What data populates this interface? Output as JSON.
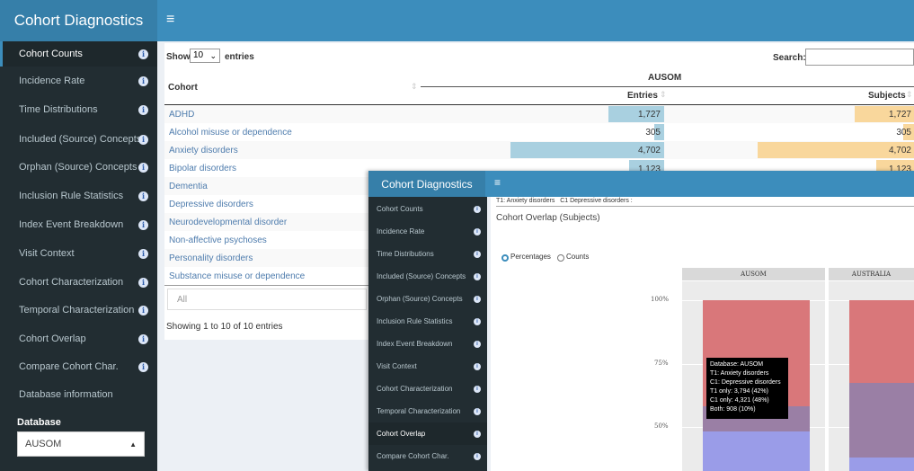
{
  "app_title": "Cohort Diagnostics",
  "menu_icon": "≡",
  "sidebar": {
    "items": [
      {
        "label": "Cohort Counts",
        "info": true
      },
      {
        "label": "Incidence Rate",
        "info": true
      },
      {
        "label": "Time Distributions",
        "info": true
      },
      {
        "label": "Included (Source) Concepts",
        "info": true
      },
      {
        "label": "Orphan (Source) Concepts",
        "info": true
      },
      {
        "label": "Inclusion Rule Statistics",
        "info": true
      },
      {
        "label": "Index Event Breakdown",
        "info": true
      },
      {
        "label": "Visit Context",
        "info": true
      },
      {
        "label": "Cohort Characterization",
        "info": true
      },
      {
        "label": "Temporal Characterization",
        "info": true
      },
      {
        "label": "Cohort Overlap",
        "info": true
      },
      {
        "label": "Compare Cohort Char.",
        "info": true
      },
      {
        "label": "Database information",
        "info": false
      }
    ],
    "database_label": "Database",
    "database_value": "AUSOM"
  },
  "table": {
    "show_label": "Show",
    "entries_value": "10",
    "entries_label": "entries",
    "search_label": "Search:",
    "col_cohort": "Cohort",
    "group_header": "AUSOM",
    "col_entries": "Entries",
    "col_subjects": "Subjects",
    "rows": [
      {
        "cohort": "ADHD",
        "entries": "1,727",
        "subjects": "1,727"
      },
      {
        "cohort": "Alcohol misuse or dependence",
        "entries": "305",
        "subjects": "305"
      },
      {
        "cohort": "Anxiety disorders",
        "entries": "4,702",
        "subjects": "4,702"
      },
      {
        "cohort": "Bipolar disorders",
        "entries": "1,123",
        "subjects": "1,123"
      },
      {
        "cohort": "Dementia",
        "entries": "",
        "subjects": ""
      },
      {
        "cohort": "Depressive disorders",
        "entries": "",
        "subjects": ""
      },
      {
        "cohort": "Neurodevelopmental disorder",
        "entries": "",
        "subjects": ""
      },
      {
        "cohort": "Non-affective psychoses",
        "entries": "",
        "subjects": ""
      },
      {
        "cohort": "Personality disorders",
        "entries": "",
        "subjects": ""
      },
      {
        "cohort": "Substance misuse or dependence",
        "entries": "",
        "subjects": ""
      }
    ],
    "filter_placeholder": "All",
    "footer": "Showing 1 to 10 of 10 entries"
  },
  "overlay": {
    "breadcrumb": "T1: Anxiety disorders   C1 Depressive disorders :",
    "title": "Cohort Overlap (Subjects)",
    "radio_percent": "Percentages",
    "radio_counts": "Counts",
    "facet1": "AUSOM",
    "facet2": "AUSTRALIA",
    "ticks": [
      "100%",
      "75%",
      "50%"
    ],
    "tooltip": [
      "Database: AUSOM",
      "T1: Anxiety disorders",
      "C1: Depressive disorders",
      "T1 only: 3,794 (42%)",
      "C1 only: 4,321 (48%)",
      "Both: 908 (10%)"
    ],
    "colors": {
      "t1": "#d9777a",
      "both": "#9a7fa5",
      "c1": "#9a9ce8"
    }
  }
}
